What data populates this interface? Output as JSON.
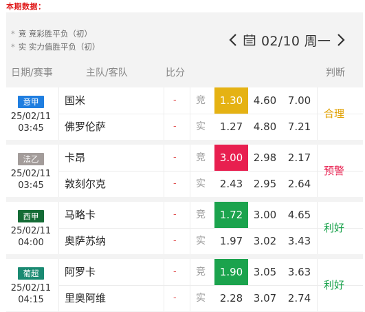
{
  "page": {
    "label": "本期数据："
  },
  "legend": {
    "items": [
      {
        "marker": "*",
        "key": "竞",
        "text": "竞彩胜平负（初）"
      },
      {
        "marker": "*",
        "key": "实",
        "text": "实力值胜平负（初）"
      }
    ]
  },
  "date_nav": {
    "prev_icon": "chevron-left-icon",
    "calendar_icon": "calendar-icon",
    "date": "02/10 周一",
    "next_icon": "chevron-right-icon"
  },
  "table_header": {
    "date": "日期/赛事",
    "teams": "主队/客队",
    "score": "比分",
    "judge": "判断"
  },
  "colors": {
    "page_label": "#e01b1b",
    "panel_bg": "#f3f3f3",
    "score_dash": "#e25555"
  },
  "matches": [
    {
      "league": "意甲",
      "league_color": "#1f7ee0",
      "date": "25/02/11",
      "time": "03:45",
      "home": "国米",
      "away": "佛罗伦萨",
      "score_home": "-",
      "score_away": "-",
      "tag1": "竞",
      "tag2": "实",
      "odds1": [
        "1.30",
        "4.60",
        "7.00"
      ],
      "odds2": [
        "1.27",
        "4.80",
        "7.21"
      ],
      "highlight_color": "#e5b213",
      "judge": "合理",
      "judge_color": "#e1a000"
    },
    {
      "league": "法乙",
      "league_color": "#a39c9a",
      "date": "25/02/11",
      "time": "03:45",
      "home": "卡昂",
      "away": "敦刻尔克",
      "score_home": "-",
      "score_away": "-",
      "tag1": "竞",
      "tag2": "实",
      "odds1": [
        "3.00",
        "2.98",
        "2.17"
      ],
      "odds2": [
        "2.43",
        "2.95",
        "2.64"
      ],
      "highlight_color": "#e81f4f",
      "judge": "预警",
      "judge_color": "#e81f4f"
    },
    {
      "league": "西甲",
      "league_color": "#146b35",
      "date": "25/02/11",
      "time": "04:00",
      "home": "马略卡",
      "away": "奥萨苏纳",
      "score_home": "-",
      "score_away": "-",
      "tag1": "竞",
      "tag2": "实",
      "odds1": [
        "1.72",
        "3.00",
        "4.65"
      ],
      "odds2": [
        "1.97",
        "3.02",
        "3.43"
      ],
      "highlight_color": "#1ba34d",
      "judge": "利好",
      "judge_color": "#1ba34d"
    },
    {
      "league": "葡超",
      "league_color": "#1a8a72",
      "date": "25/02/11",
      "time": "04:15",
      "home": "阿罗卡",
      "away": "里奥阿维",
      "score_home": "-",
      "score_away": "-",
      "tag1": "竞",
      "tag2": "实",
      "odds1": [
        "1.90",
        "3.05",
        "3.63"
      ],
      "odds2": [
        "2.28",
        "3.07",
        "2.74"
      ],
      "highlight_color": "#1ba34d",
      "judge": "利好",
      "judge_color": "#1ba34d"
    }
  ]
}
